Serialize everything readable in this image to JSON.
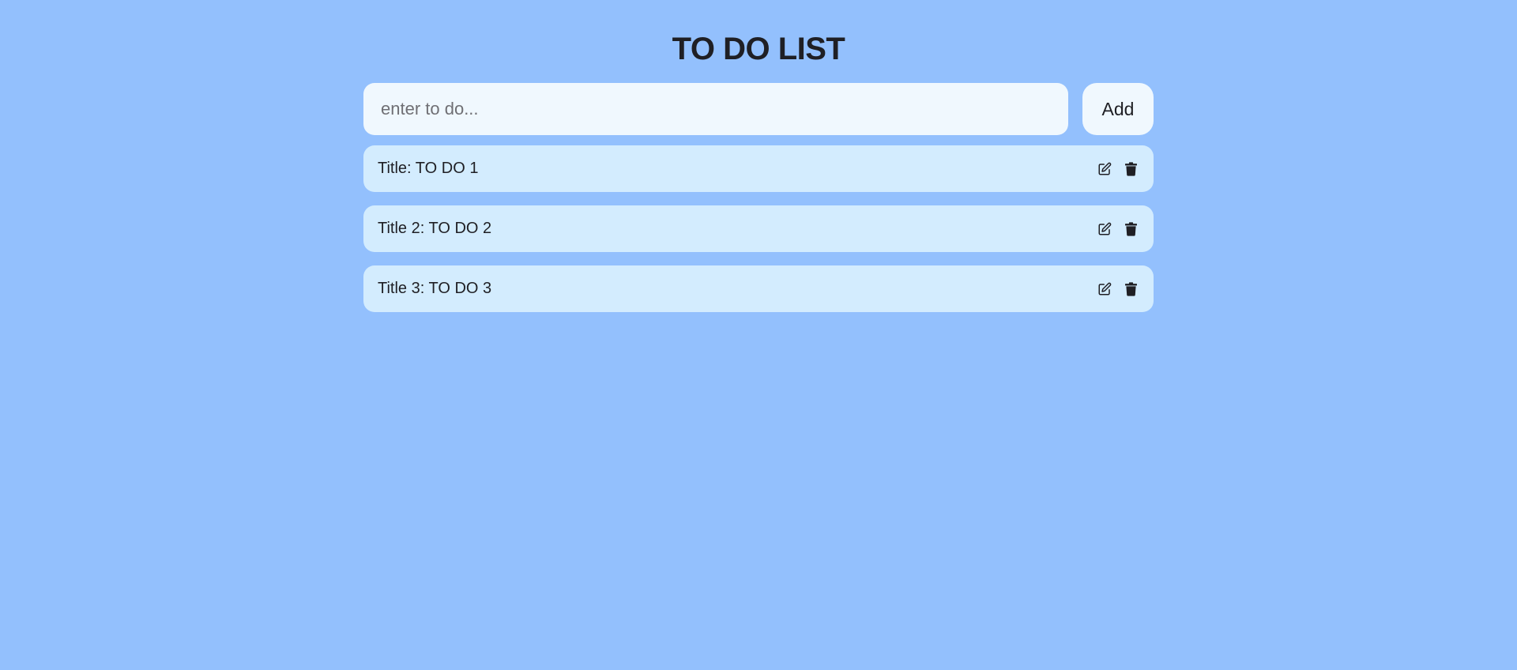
{
  "header": {
    "title": "TO DO LIST"
  },
  "input": {
    "value": "",
    "placeholder": "enter to do..."
  },
  "add_button": {
    "label": "Add"
  },
  "todos": [
    {
      "label": "Title: TO DO 1",
      "edit_icon": "edit-icon",
      "delete_icon": "trash-icon"
    },
    {
      "label": "Title 2: TO DO 2",
      "edit_icon": "edit-icon",
      "delete_icon": "trash-icon"
    },
    {
      "label": "Title 3: TO DO 3",
      "edit_icon": "edit-icon",
      "delete_icon": "trash-icon"
    }
  ],
  "colors": {
    "background": "#93c0fd",
    "input_bg": "#f0f8fe",
    "item_bg": "#d3ecfe",
    "text": "#1f1f24"
  }
}
